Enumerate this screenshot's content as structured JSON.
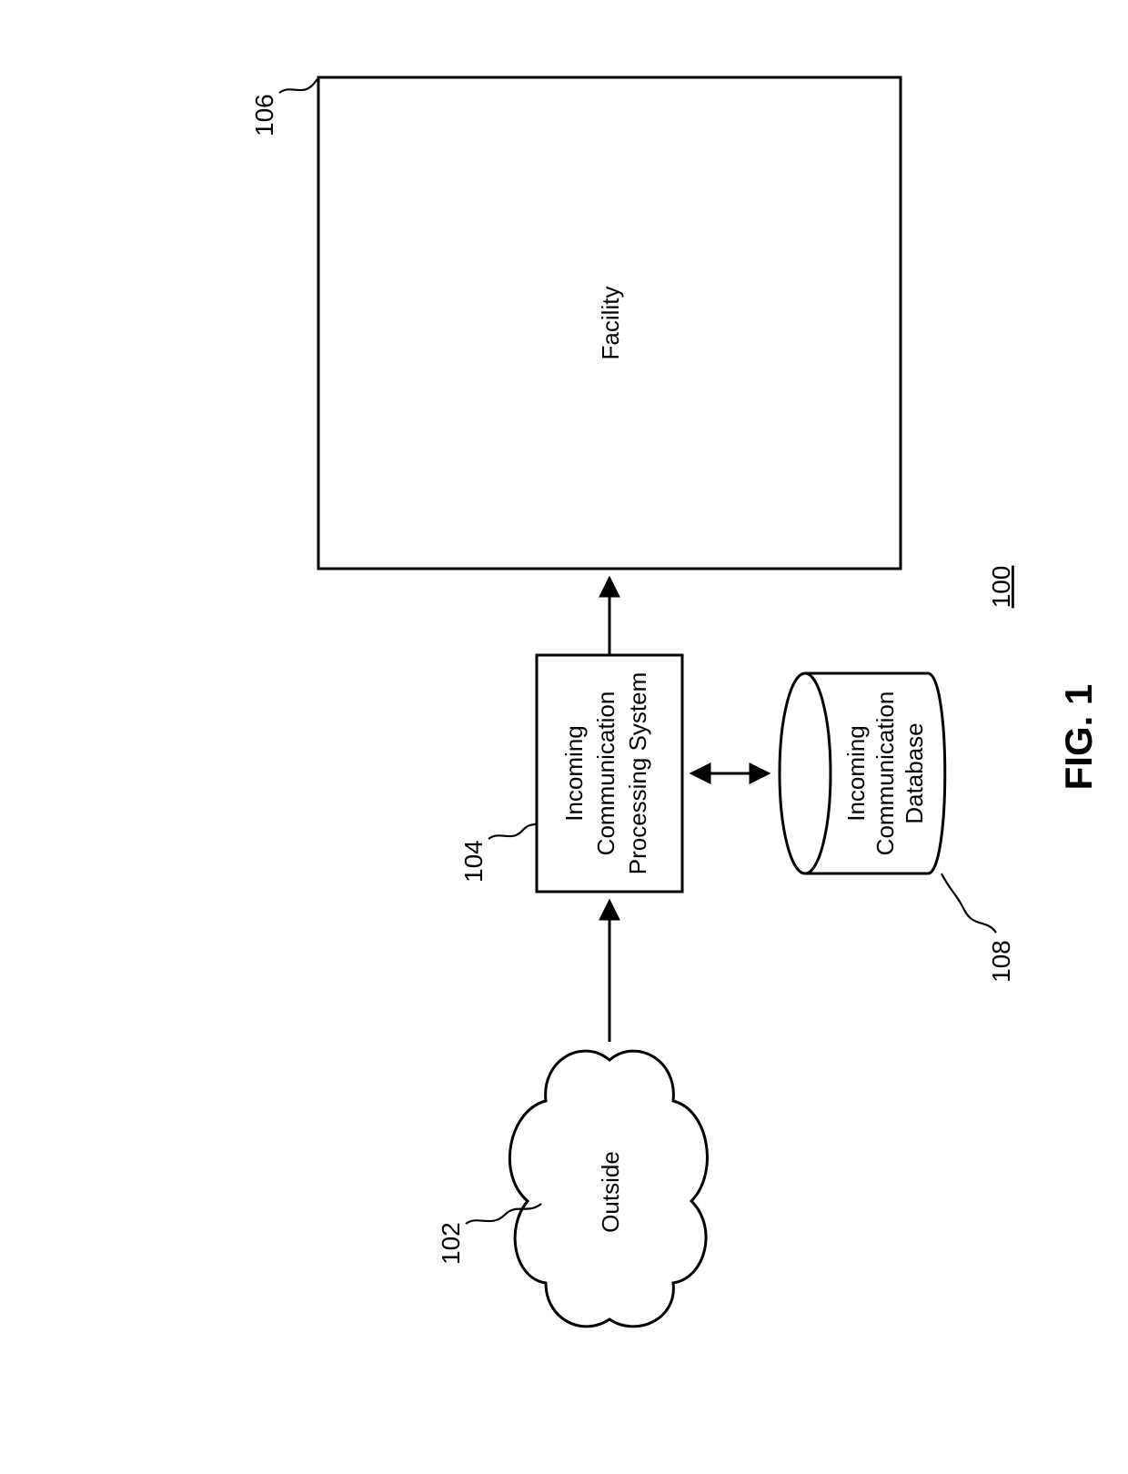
{
  "figure": {
    "caption": "FIG. 1",
    "system_ref": "100"
  },
  "nodes": {
    "outside": {
      "label": "Outside",
      "ref": "102"
    },
    "processor": {
      "label_line1": "Incoming",
      "label_line2": "Communication",
      "label_line3": "Processing System",
      "ref": "104"
    },
    "facility": {
      "label": "Facility",
      "ref": "106"
    },
    "database": {
      "label_line1": "Incoming",
      "label_line2": "Communication",
      "label_line3": "Database",
      "ref": "108"
    }
  }
}
